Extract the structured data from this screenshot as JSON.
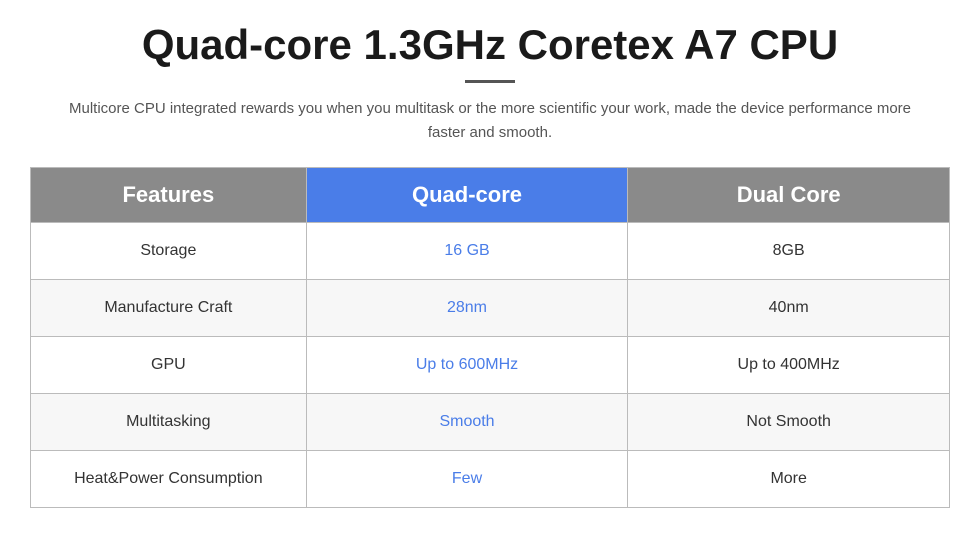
{
  "page": {
    "title": "Quad-core 1.3GHz Coretex A7 CPU",
    "subtitle": "Multicore CPU integrated rewards you when you multitask or the more scientific your work, made the device performance more faster and smooth.",
    "divider": true
  },
  "table": {
    "headers": {
      "features": "Features",
      "quadcore": "Quad-core",
      "dualcore": "Dual Core"
    },
    "rows": [
      {
        "feature": "Storage",
        "quad_value": "16 GB",
        "dual_value": "8GB"
      },
      {
        "feature": "Manufacture Craft",
        "quad_value": "28nm",
        "dual_value": "40nm"
      },
      {
        "feature": "GPU",
        "quad_value": "Up to 600MHz",
        "dual_value": "Up to 400MHz"
      },
      {
        "feature": "Multitasking",
        "quad_value": "Smooth",
        "dual_value": "Not Smooth"
      },
      {
        "feature": "Heat&Power Consumption",
        "quad_value": "Few",
        "dual_value": "More"
      }
    ]
  }
}
